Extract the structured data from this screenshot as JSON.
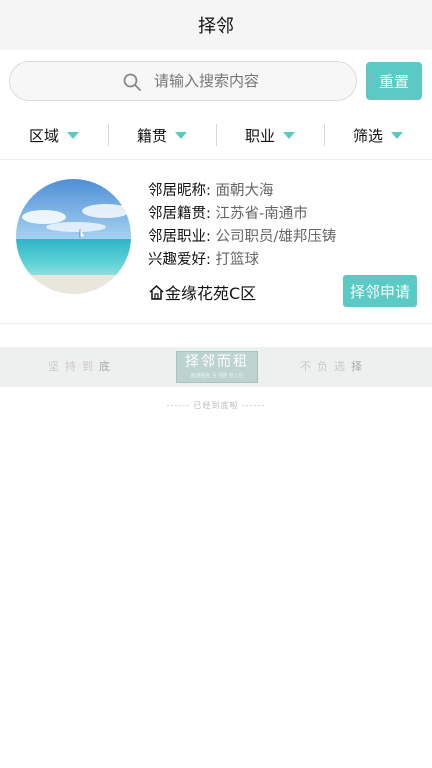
{
  "header": {
    "title": "择邻"
  },
  "search": {
    "placeholder": "请输入搜索内容",
    "icon": "search-icon",
    "reset_label": "重置"
  },
  "filters": [
    {
      "label": "区域",
      "icon": "caret-down-icon"
    },
    {
      "label": "籍贯",
      "icon": "caret-down-icon"
    },
    {
      "label": "职业",
      "icon": "caret-down-icon"
    },
    {
      "label": "筛选",
      "icon": "caret-down-icon"
    }
  ],
  "listing": {
    "nickname_label": "邻居昵称:",
    "nickname": "面朝大海",
    "hometown_label": "邻居籍贯:",
    "hometown": "江苏省-南通市",
    "job_label": "邻居职业:",
    "job": "公司职员/雄邦压铸",
    "hobby_label": "兴趣爱好:",
    "hobby": "打篮球",
    "address": "金缘花苑C区",
    "apply_label": "择邻申请"
  },
  "banner": {
    "left_text": "坚持到",
    "left_end": "底",
    "logo_title": "择邻而租",
    "logo_sub": "南通租房 互邻圈 安心住",
    "right_text": "不负选",
    "right_end": "择"
  },
  "footer": {
    "end_text": "------  已经到底啦  ------"
  },
  "colors": {
    "accent": "#5bc9c4",
    "titlebar_bg": "#f5f5f5"
  }
}
